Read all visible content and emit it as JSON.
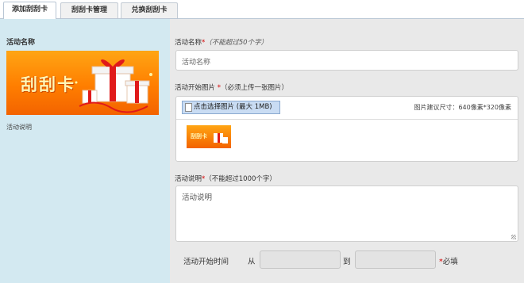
{
  "tabs": [
    {
      "label": "添加刮刮卡"
    },
    {
      "label": "刮刮卡管理"
    },
    {
      "label": "兑换刮刮卡"
    }
  ],
  "preview": {
    "title": "活动名称",
    "banner_text": "刮刮卡",
    "description": "活动说明"
  },
  "form": {
    "name": {
      "label": "活动名称",
      "required_mark": "*",
      "hint": "（不能超过50个字）",
      "placeholder": "活动名称"
    },
    "image": {
      "label": "活动开始图片",
      "required_mark": "*",
      "hint": "（必须上传一张图片）",
      "upload_button": "点击选择图片 (最大 1MB)",
      "size_hint": "图片建议尺寸：640像素*320像素",
      "thumb_text": "刮刮卡"
    },
    "description": {
      "label": "活动说明",
      "required_mark": "*",
      "hint": "（不能超过1000个字）",
      "value": "活动说明"
    },
    "time": {
      "label": "活动开始时间",
      "from": "从",
      "to": "到",
      "required_mark": "*",
      "required_text": "必填"
    }
  },
  "colors": {
    "left_panel": "#d3e9f1",
    "right_panel": "#e9e9e9",
    "banner": "#ff7e00",
    "required": "#d40000"
  }
}
